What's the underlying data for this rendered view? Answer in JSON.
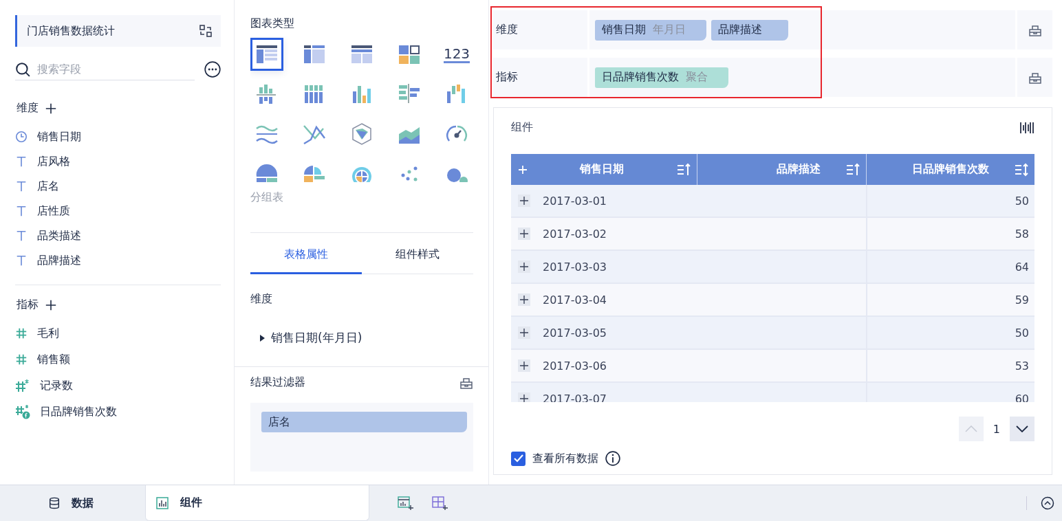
{
  "sidebar": {
    "title": "门店销售数据统计",
    "search": {
      "placeholder": "搜索字段"
    },
    "dimension_section": {
      "label": "维度",
      "fields": [
        {
          "name": "销售日期",
          "kind": "date"
        },
        {
          "name": "店风格",
          "kind": "text"
        },
        {
          "name": "店名",
          "kind": "text"
        },
        {
          "name": "店性质",
          "kind": "text"
        },
        {
          "name": "品类描述",
          "kind": "text"
        },
        {
          "name": "品牌描述",
          "kind": "text"
        }
      ]
    },
    "measure_section": {
      "label": "指标",
      "fields": [
        {
          "name": "毛利",
          "kind": "number"
        },
        {
          "name": "销售额",
          "kind": "number"
        },
        {
          "name": "记录数",
          "kind": "calc"
        },
        {
          "name": "日品牌销售次数",
          "kind": "formula"
        }
      ]
    }
  },
  "chart_types": {
    "title": "图表类型",
    "caption": "分组表",
    "types": [
      {
        "kind": "grouped-table",
        "selected": true
      },
      {
        "kind": "cross-table",
        "selected": false
      },
      {
        "kind": "detail-table",
        "selected": false
      },
      {
        "kind": "blocks",
        "selected": false
      },
      {
        "kind": "number",
        "selected": false,
        "label": "123"
      },
      {
        "kind": "bar-diverging",
        "selected": false
      },
      {
        "kind": "bar-stacked",
        "selected": false
      },
      {
        "kind": "bar",
        "selected": false
      },
      {
        "kind": "bar-horizontal",
        "selected": false
      },
      {
        "kind": "waterfall",
        "selected": false
      },
      {
        "kind": "wave",
        "selected": false
      },
      {
        "kind": "line",
        "selected": false
      },
      {
        "kind": "radar",
        "selected": false
      },
      {
        "kind": "area",
        "selected": false
      },
      {
        "kind": "gauge",
        "selected": false
      },
      {
        "kind": "pie",
        "selected": false
      },
      {
        "kind": "pie-rose",
        "selected": false
      },
      {
        "kind": "sunburst",
        "selected": false
      },
      {
        "kind": "scatter",
        "selected": false
      },
      {
        "kind": "bubble",
        "selected": false
      }
    ]
  },
  "properties": {
    "tabs": [
      {
        "label": "表格属性",
        "selected": true
      },
      {
        "label": "组件样式",
        "selected": false
      }
    ],
    "section": "维度",
    "items": [
      {
        "label": "销售日期(年月日)",
        "expanded": false
      }
    ]
  },
  "result_filter": {
    "title": "结果过滤器",
    "chips": [
      "店名"
    ]
  },
  "shelves": [
    {
      "label": "维度",
      "kind": "dimension",
      "chips": [
        {
          "name": "销售日期",
          "suffix": "年月日"
        },
        {
          "name": "品牌描述"
        }
      ]
    },
    {
      "label": "指标",
      "kind": "measure",
      "chips": [
        {
          "name": "日品牌销售次数",
          "suffix": "聚合"
        }
      ]
    }
  ],
  "component": {
    "title": "组件",
    "table": {
      "columns": [
        {
          "label": "销售日期"
        },
        {
          "label": "品牌描述"
        },
        {
          "label": "日品牌销售次数"
        }
      ],
      "rows": [
        {
          "cells": [
            "2017-03-01",
            "",
            "50"
          ]
        },
        {
          "cells": [
            "2017-03-02",
            "",
            "58"
          ]
        },
        {
          "cells": [
            "2017-03-03",
            "",
            "64"
          ]
        },
        {
          "cells": [
            "2017-03-04",
            "",
            "59"
          ]
        },
        {
          "cells": [
            "2017-03-05",
            "",
            "50"
          ]
        },
        {
          "cells": [
            "2017-03-06",
            "",
            "53"
          ]
        },
        {
          "cells": [
            "2017-03-07",
            "",
            "60"
          ]
        }
      ]
    },
    "pager": {
      "page": "1"
    },
    "show_all": {
      "label": "查看所有数据",
      "checked": true
    }
  },
  "bottom_tabs": [
    {
      "label": "数据",
      "kind": "data",
      "selected": false
    },
    {
      "label": "组件",
      "kind": "component",
      "selected": true
    }
  ]
}
